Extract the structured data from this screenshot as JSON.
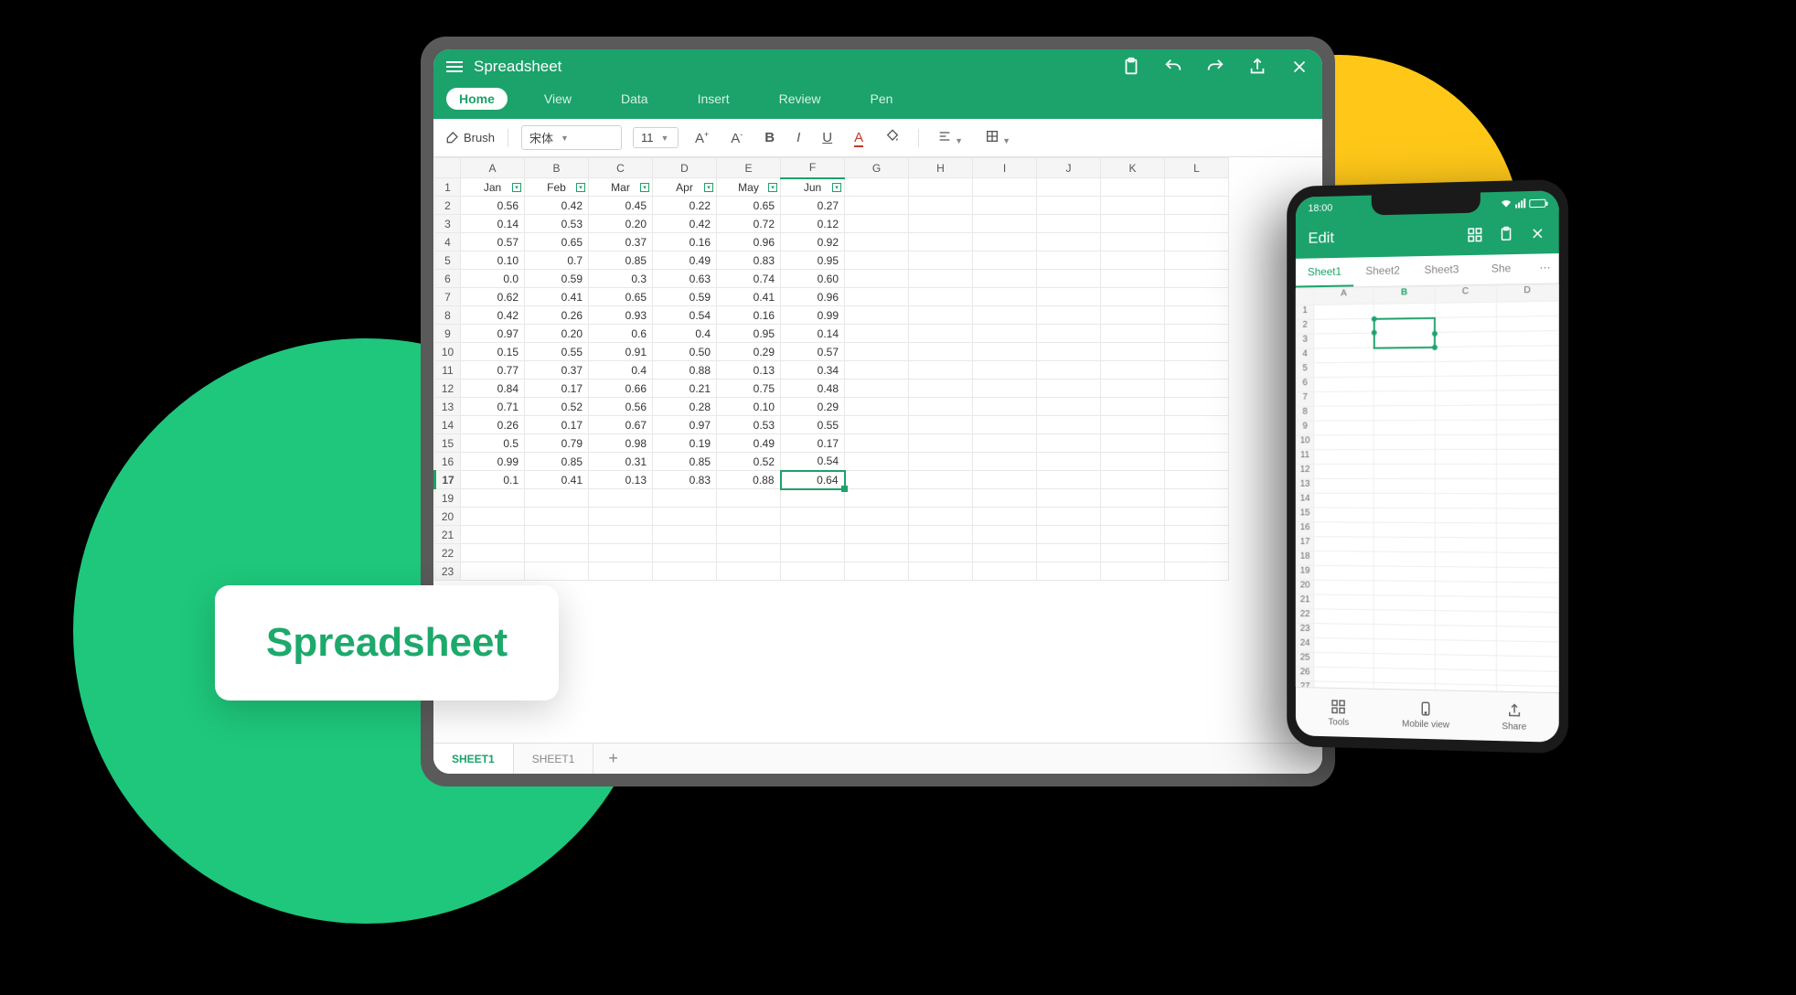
{
  "label": "Spreadsheet",
  "tablet": {
    "title": "Spreadsheet",
    "tabs": [
      "Home",
      "View",
      "Data",
      "Insert",
      "Review",
      "Pen"
    ],
    "toolbar": {
      "brush": "Brush",
      "font": "宋体",
      "size": "11"
    },
    "cols": [
      "A",
      "B",
      "C",
      "D",
      "E",
      "F",
      "G",
      "H",
      "I",
      "J",
      "K",
      "L"
    ],
    "headers": [
      "Jan",
      "Feb",
      "Mar",
      "Apr",
      "May",
      "Jun"
    ],
    "rows": [
      [
        "0.56",
        "0.42",
        "0.45",
        "0.22",
        "0.65",
        "0.27"
      ],
      [
        "0.14",
        "0.53",
        "0.20",
        "0.42",
        "0.72",
        "0.12"
      ],
      [
        "0.57",
        "0.65",
        "0.37",
        "0.16",
        "0.96",
        "0.92"
      ],
      [
        "0.10",
        "0.7",
        "0.85",
        "0.49",
        "0.83",
        "0.95"
      ],
      [
        "0.0",
        "0.59",
        "0.3",
        "0.63",
        "0.74",
        "0.60"
      ],
      [
        "0.62",
        "0.41",
        "0.65",
        "0.59",
        "0.41",
        "0.96"
      ],
      [
        "0.42",
        "0.26",
        "0.93",
        "0.54",
        "0.16",
        "0.99"
      ],
      [
        "0.97",
        "0.20",
        "0.6",
        "0.4",
        "0.95",
        "0.14"
      ],
      [
        "0.15",
        "0.55",
        "0.91",
        "0.50",
        "0.29",
        "0.57"
      ],
      [
        "0.77",
        "0.37",
        "0.4",
        "0.88",
        "0.13",
        "0.34"
      ],
      [
        "0.84",
        "0.17",
        "0.66",
        "0.21",
        "0.75",
        "0.48"
      ],
      [
        "0.71",
        "0.52",
        "0.56",
        "0.28",
        "0.10",
        "0.29"
      ],
      [
        "0.26",
        "0.17",
        "0.67",
        "0.97",
        "0.53",
        "0.55"
      ],
      [
        "0.5",
        "0.79",
        "0.98",
        "0.19",
        "0.49",
        "0.17"
      ],
      [
        "0.99",
        "0.85",
        "0.31",
        "0.85",
        "0.52",
        "0.54"
      ],
      [
        "0.1",
        "0.41",
        "0.13",
        "0.83",
        "0.88",
        "0.64"
      ]
    ],
    "empty_rows": [
      19,
      20,
      21,
      22,
      23
    ],
    "selected": {
      "row": 17,
      "col": 6
    },
    "sheets": [
      "SHEET1",
      "SHEET1"
    ]
  },
  "phone": {
    "time": "18:00",
    "title": "Edit",
    "sheets": [
      "Sheet1",
      "Sheet2",
      "Sheet3",
      "She"
    ],
    "cols": [
      "A",
      "B",
      "C",
      "D"
    ],
    "row_count": 28,
    "footer": {
      "tools": "Tools",
      "mobile": "Mobile view",
      "share": "Share"
    }
  }
}
